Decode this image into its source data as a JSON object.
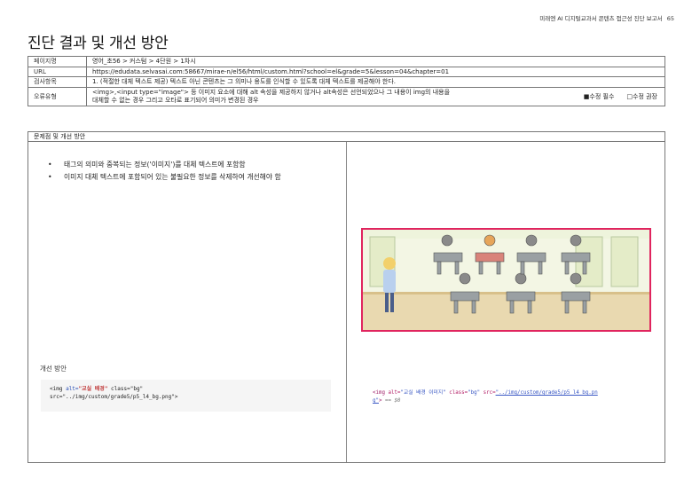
{
  "header": {
    "report_title": "미래엔 AI 디지털교과서 콘텐츠 접근성 진단 보고서",
    "page_number": "65"
  },
  "page_title": "진단 결과 및 개선 방안",
  "info": {
    "page_label": "페이지명",
    "page_value": "영어_초56 > 커스텀 > 4단원 > 1차시",
    "url_label": "URL",
    "url_value": "https://edudata.selvasai.com:58667/mirae-n/el56/html/custom.html?school=el&grade=5&lesson=04&chapter=01",
    "check_label": "검사항목",
    "check_value": "1. (적절한 대체 텍스트 제공) 텍스트 아닌 콘텐츠는 그 의미나 용도를 인식할 수 있도록 대체 텍스트를 제공해야 한다.",
    "error_label": "오류유형",
    "error_value_line1": "<img>,<input type=\"image\"> 등 이미지 요소에 대해 alt 속성을 제공하지 않거나 alt속성은 선언되었으나 그 내용이 img의 내용을",
    "error_value_line2": "대체할 수 없는 경우 그리고 오타로 표기되어 의미가 변경된 경우",
    "mark_required": "■수정 필수",
    "mark_recommended": "□수정 권장"
  },
  "problem": {
    "heading": "문제점 및 개선 방안",
    "bullets": [
      "태그의 의미와 중복되는 정보('이미지')를 대체 텍스트에 포함함",
      "이미지 대체 텍스트에 포함되어 있는 불필요한 정보를 삭제하여 개선해야 함"
    ],
    "improve_label": "개선 방안",
    "fixed_code": {
      "p1": "<img ",
      "a1": "alt=",
      "s1": "\"교실 배경\"",
      "p2": " class=\"bg\"",
      "line2": "src=\"../img/custom/grade5/p5_l4_bg.png\">"
    },
    "bad_code": {
      "t1": "<img ",
      "a1": "alt=",
      "s1": "\"교실 배경 이미지\"",
      "a2": " class=",
      "s2": "\"bg\"",
      "a3": " src=",
      "link1": "\"../img/custom/grade5/p5_l4_bg.pn",
      "link2": "g\"",
      "t2": "> ",
      "cmt": "== $0"
    }
  },
  "colors": {
    "highlight_border": "#e0245e",
    "code_string": "#c03a3a",
    "code_attr": "#2a4fb5"
  }
}
